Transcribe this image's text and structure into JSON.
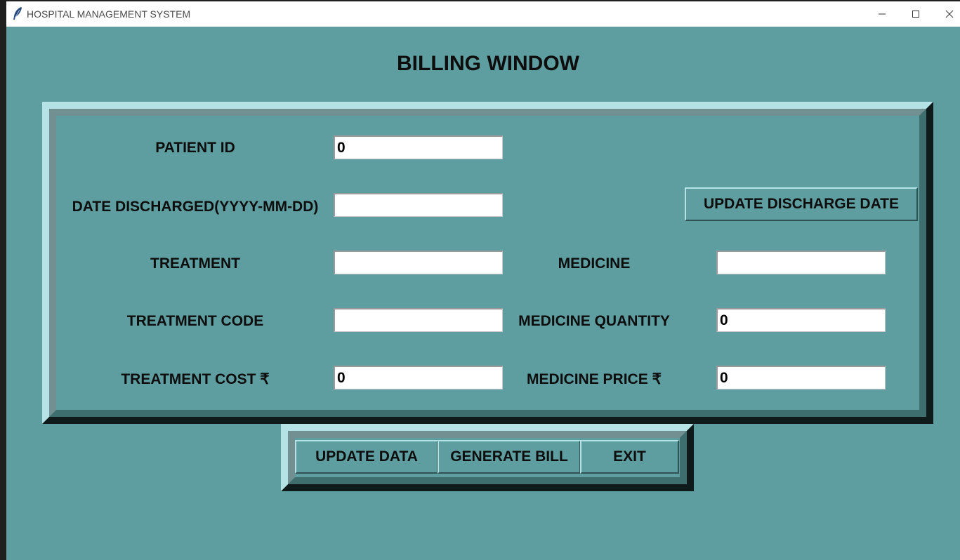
{
  "window": {
    "title": "HOSPITAL MANAGEMENT SYSTEM",
    "controls": {
      "minimize": "─",
      "maximize": "☐",
      "close": "✕"
    }
  },
  "heading": "BILLING WINDOW",
  "form": {
    "patient_id": {
      "label": "PATIENT ID",
      "value": "0"
    },
    "date_discharged": {
      "label": "DATE DISCHARGED(YYYY-MM-DD)",
      "value": ""
    },
    "update_discharge_button": "UPDATE DISCHARGE DATE",
    "treatment": {
      "label": "TREATMENT",
      "value": ""
    },
    "treatment_code": {
      "label": "TREATMENT CODE",
      "value": ""
    },
    "treatment_cost": {
      "label": "TREATMENT COST ₹",
      "value": "0"
    },
    "medicine": {
      "label": "MEDICINE",
      "value": ""
    },
    "medicine_quantity": {
      "label": "MEDICINE QUANTITY",
      "value": "0"
    },
    "medicine_price": {
      "label": "MEDICINE PRICE ₹",
      "value": "0"
    }
  },
  "buttons": {
    "update_data": "UPDATE DATA",
    "generate_bill": "GENERATE BILL",
    "exit": "EXIT"
  },
  "colors": {
    "background": "#5f9ea0",
    "frame_light": "#b5e2e5",
    "frame_dark": "#3f6e6f"
  }
}
